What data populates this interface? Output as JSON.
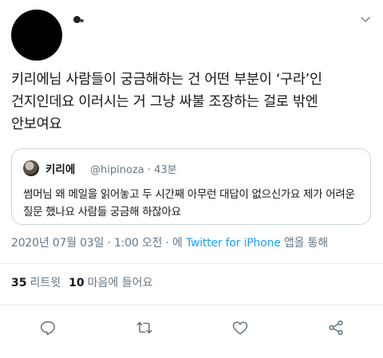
{
  "author": {
    "avatar": "redacted-black-circle",
    "name_icon": "redacted-blob"
  },
  "tweet": {
    "lines": [
      "키리에님 사람들이 궁금해하는 건 어떤 부분이 ‘구라’인",
      "건지인데요 이러시는 거 그냥 싸불 조장하는 걸로 밖엔",
      "안보여요"
    ]
  },
  "quote": {
    "name": "키리에",
    "handle_time": "@hipinoza · 43분",
    "lines": [
      "썸머님 왜 메일을 읽어놓고 두 시간째 아무런 대답이 없으신가요 제가 어려운",
      "질문 했나요 사람들 궁금해 하잖아요"
    ]
  },
  "meta": {
    "datetime": "2020년 07월 03일 · 1:00 오전 · 에",
    "client": "Twitter for iPhone",
    "suffix": "앱을 통해"
  },
  "stats": {
    "retweets_count": "35",
    "retweets_label": "리트윗",
    "likes_count": "10",
    "likes_label": "마음에 들어요"
  },
  "icons": {
    "caret": "chevron-down-icon",
    "reply": "reply-icon",
    "retweet": "retweet-icon",
    "like": "heart-icon",
    "share": "share-icon"
  },
  "colors": {
    "text": "#14171a",
    "secondary": "#657786",
    "link": "#1da1f2",
    "border": "#ccd6dd"
  }
}
